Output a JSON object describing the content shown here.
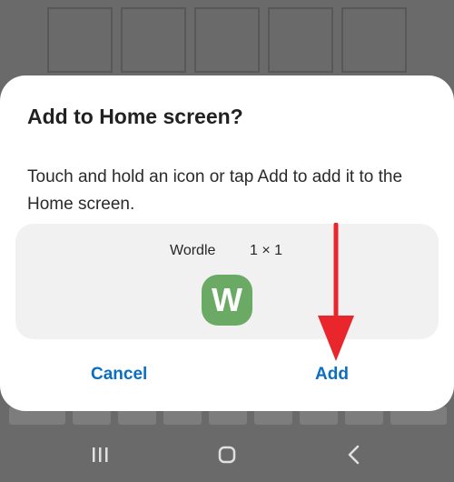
{
  "dialog": {
    "title": "Add to Home screen?",
    "message": "Touch and hold an icon or tap Add to add it to the Home screen.",
    "preview": {
      "app_name": "Wordle",
      "widget_size": "1 × 1",
      "icon_letter": "W",
      "icon_name": "wordle-app-icon",
      "icon_color": "#6aaa64"
    },
    "cancel_label": "Cancel",
    "add_label": "Add",
    "button_color": "#0a6fc2"
  },
  "annotation": {
    "arrow_color": "#e8262c"
  },
  "navigation_bar": {
    "buttons": [
      {
        "icon": "recent-apps-icon"
      },
      {
        "icon": "home-icon"
      },
      {
        "icon": "back-icon"
      }
    ]
  }
}
